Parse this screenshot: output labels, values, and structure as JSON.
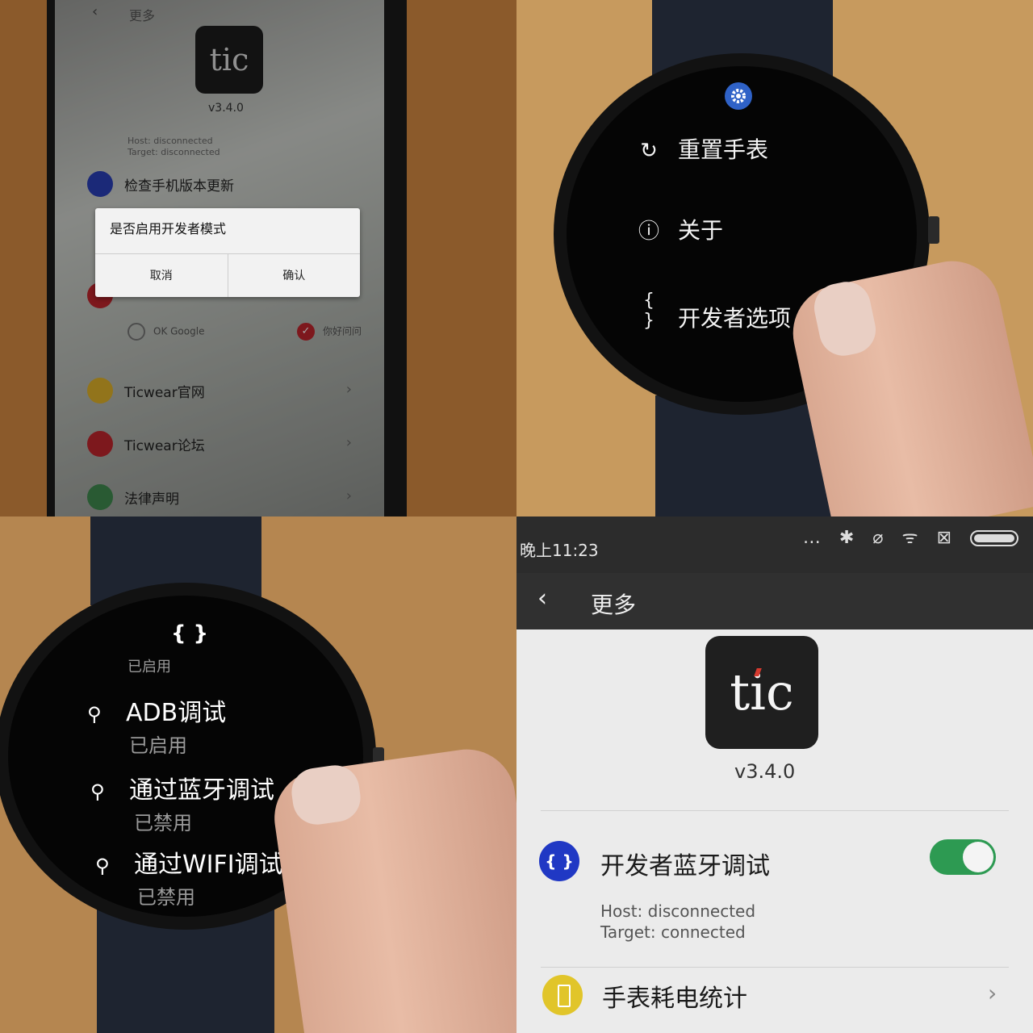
{
  "q1": {
    "back": "‹",
    "title": "更多",
    "logo": "tic",
    "version": "v3.4.0",
    "host": "Host: disconnected",
    "target": "Target: disconnected",
    "check_update": "检查手机版本更新",
    "dialog": {
      "message": "是否启用开发者模式",
      "cancel": "取消",
      "confirm": "确认"
    },
    "voice_options": [
      "OK Google",
      "你好问问"
    ],
    "rows": [
      "Ticwear官网",
      "Ticwear论坛",
      "法律声明"
    ]
  },
  "q2": {
    "menu": [
      {
        "icon": "↻",
        "label": "重置手表"
      },
      {
        "icon": "ⓘ",
        "label": "关于"
      },
      {
        "icon": "{ }",
        "label": "开发者选项"
      }
    ]
  },
  "q3": {
    "header_icon": "{ }",
    "cut_label": "已启用",
    "items": [
      {
        "label": "ADB调试",
        "status": "已启用"
      },
      {
        "label": "通过蓝牙调试",
        "status": "已禁用"
      },
      {
        "label": "通过WIFI调试",
        "status": "已禁用"
      }
    ]
  },
  "q4": {
    "time": "晚上11:23",
    "status_icons": "… ✱ ⌀ ᯤ ⊠",
    "back": "‹",
    "title": "更多",
    "logo": "tic",
    "version": "v3.4.0",
    "dev_icon": "{ }",
    "dev_label": "开发者蓝牙调试",
    "dev_toggle": true,
    "host": "Host: disconnected",
    "target": "Target: connected",
    "battery_label": "手表耗电统计",
    "chevron": "›"
  },
  "colors": {
    "accent_blue": "#2038c4",
    "toggle_green": "#2d9a52",
    "battery_yellow": "#e1c52a",
    "tic_red": "#d73a2f"
  }
}
